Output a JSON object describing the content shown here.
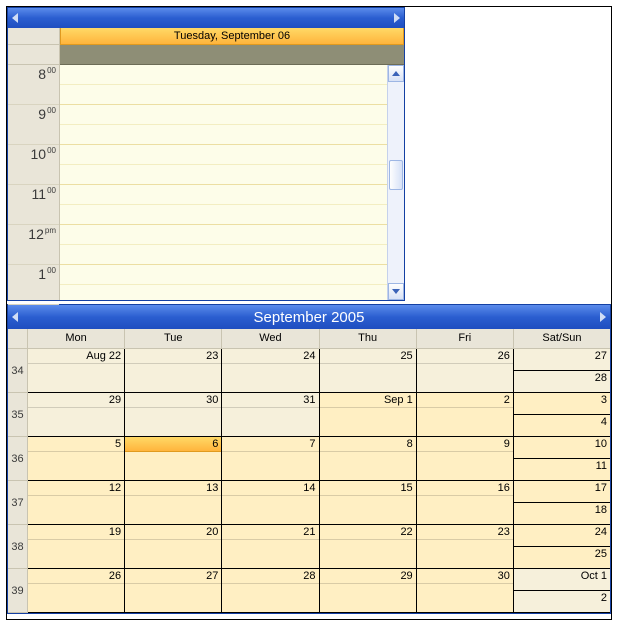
{
  "day_view": {
    "date_header": "Tuesday, September 06",
    "time_slots": [
      {
        "hour": "8",
        "suffix": "00"
      },
      {
        "hour": "9",
        "suffix": "00"
      },
      {
        "hour": "10",
        "suffix": "00"
      },
      {
        "hour": "11",
        "suffix": "00"
      },
      {
        "hour": "12",
        "suffix": "pm"
      },
      {
        "hour": "1",
        "suffix": "00"
      }
    ]
  },
  "month_view": {
    "title": "September 2005",
    "dow": [
      "Mon",
      "Tue",
      "Wed",
      "Thu",
      "Fri",
      "Sat/Sun"
    ],
    "weeks": [
      {
        "num": "34",
        "days": [
          "Aug 22",
          "23",
          "24",
          "25",
          "26"
        ],
        "weekend": [
          "27",
          "28"
        ]
      },
      {
        "num": "35",
        "days": [
          "29",
          "30",
          "31",
          "Sep 1",
          "2"
        ],
        "weekend": [
          "3",
          "4"
        ]
      },
      {
        "num": "36",
        "days": [
          "5",
          "6",
          "7",
          "8",
          "9"
        ],
        "weekend": [
          "10",
          "11"
        ],
        "today_index": 1
      },
      {
        "num": "37",
        "days": [
          "12",
          "13",
          "14",
          "15",
          "16"
        ],
        "weekend": [
          "17",
          "18"
        ]
      },
      {
        "num": "38",
        "days": [
          "19",
          "20",
          "21",
          "22",
          "23"
        ],
        "weekend": [
          "24",
          "25"
        ]
      },
      {
        "num": "39",
        "days": [
          "26",
          "27",
          "28",
          "29",
          "30"
        ],
        "weekend": [
          "Oct 1",
          "2"
        ]
      }
    ]
  }
}
